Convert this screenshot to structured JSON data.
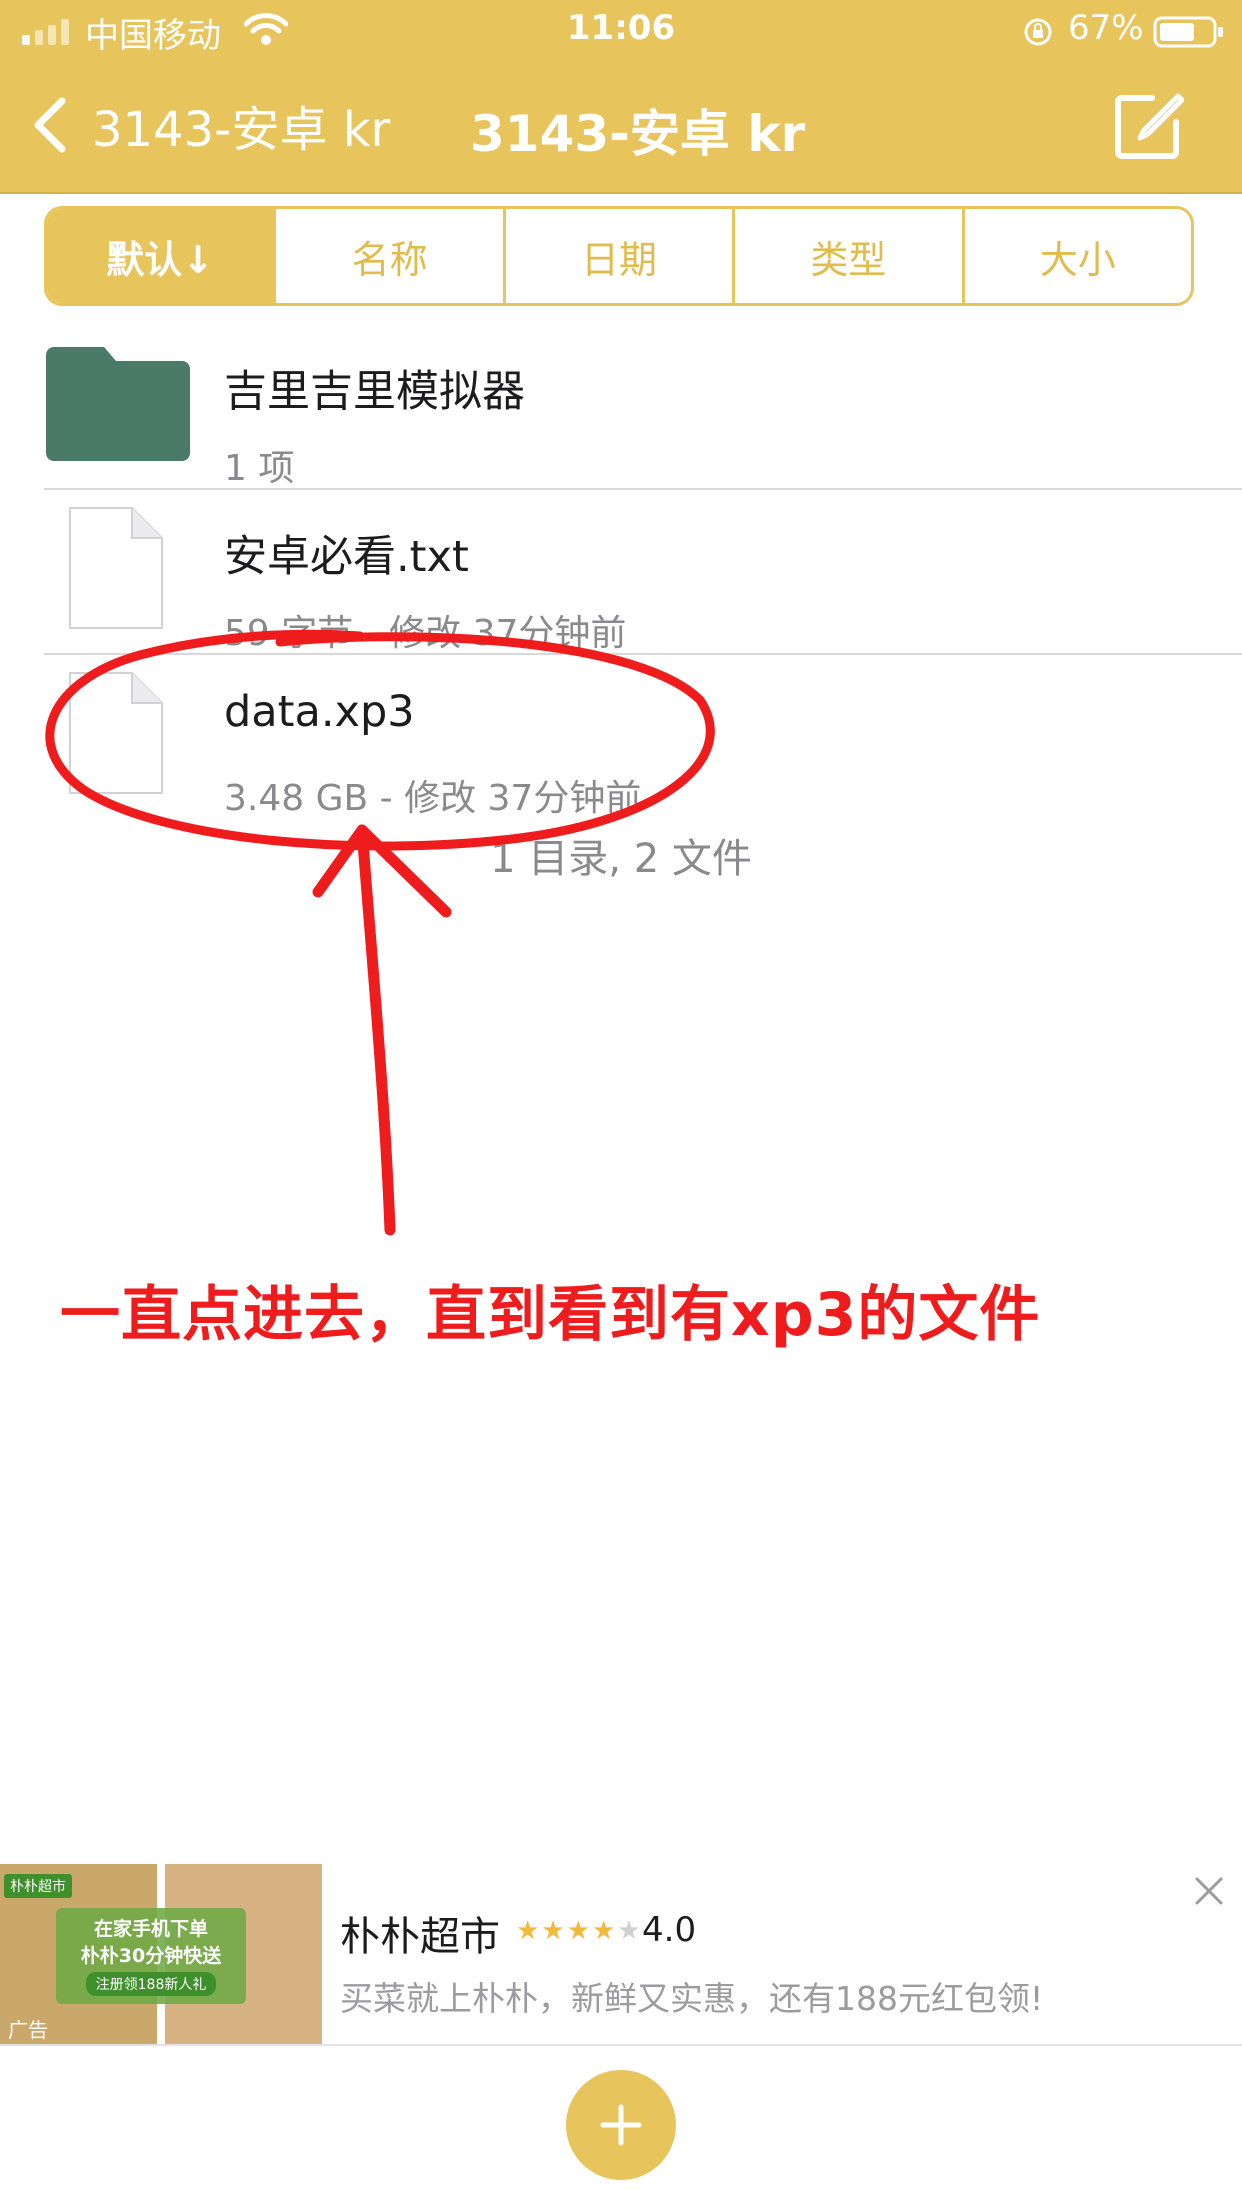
{
  "status_bar": {
    "carrier": "中国移动",
    "time": "11:06",
    "battery_percent": "67%",
    "icons": [
      "signal-icon",
      "wifi-icon",
      "orientation-lock-icon",
      "battery-icon"
    ]
  },
  "nav": {
    "back_label": "3143-安卓 kr",
    "title": "3143-安卓 kr",
    "edit_icon": "compose-icon"
  },
  "sort_tabs": [
    {
      "label": "默认↓",
      "selected": true
    },
    {
      "label": "名称",
      "selected": false
    },
    {
      "label": "日期",
      "selected": false
    },
    {
      "label": "类型",
      "selected": false
    },
    {
      "label": "大小",
      "selected": false
    }
  ],
  "files": [
    {
      "name": "吉里吉里模拟器",
      "meta": "1 项",
      "icon": "folder-icon"
    },
    {
      "name": "安卓必看.txt",
      "meta": "59 字节 - 修改 37分钟前",
      "icon": "document-icon"
    },
    {
      "name": "data.xp3",
      "meta": "3.48 GB - 修改 37分钟前",
      "icon": "document-icon"
    }
  ],
  "summary": "1 目录, 2 文件",
  "annotation": {
    "text": "一直点进去，直到看到有xp3的文件",
    "color": "#ee1c1c"
  },
  "ad": {
    "title": "朴朴超市",
    "rating": "4.0",
    "stars": 4,
    "description": "买菜就上朴朴，新鲜又实惠，还有188元红包领!",
    "tag": "广告",
    "brand": "朴朴超市",
    "promo_line1": "在家手机下单",
    "promo_line2": "朴朴30分钟快送",
    "promo_line3": "注册领188新人礼"
  },
  "colors": {
    "header": "#e7c55c",
    "folder": "#4a7a68",
    "annotation": "#ee1c1c"
  }
}
